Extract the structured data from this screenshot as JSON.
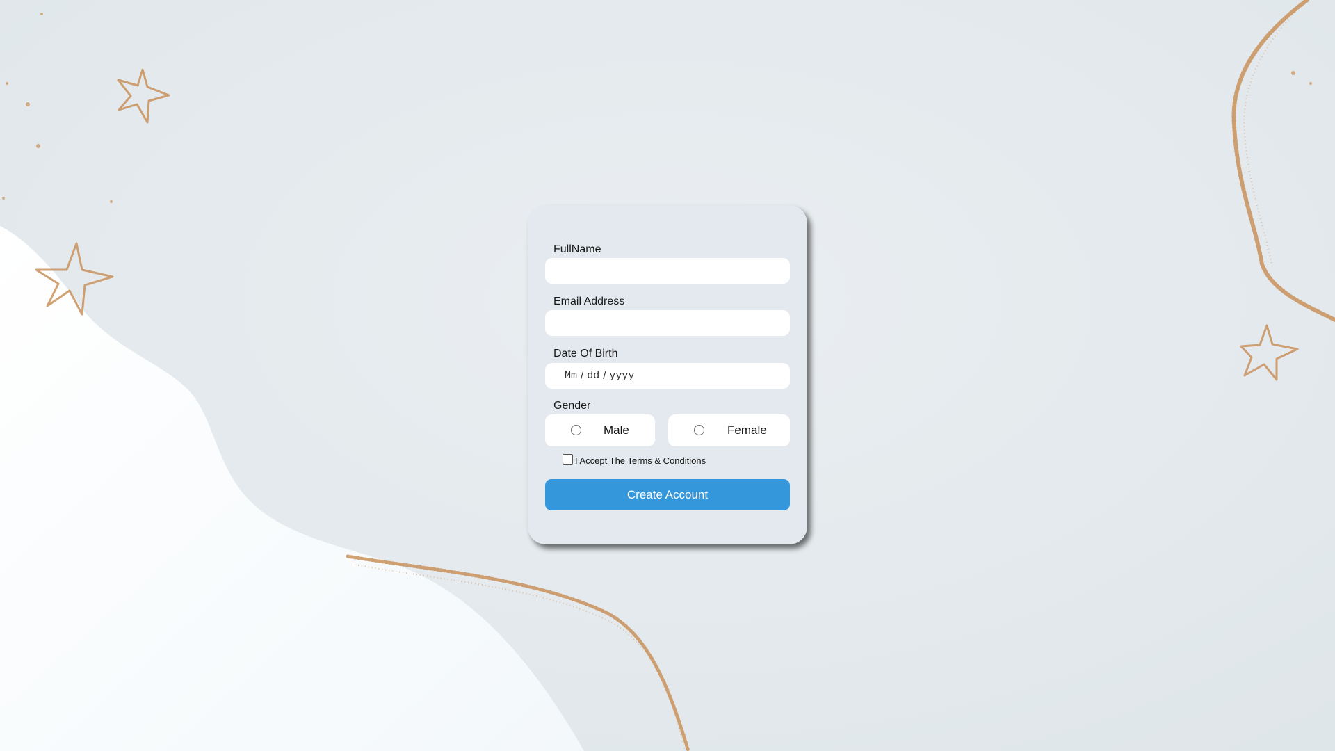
{
  "form": {
    "fullname": {
      "label": "FullName",
      "value": ""
    },
    "email": {
      "label": "Email Address",
      "value": ""
    },
    "dob": {
      "label": "Date Of Birth",
      "month_placeholder": "Mm",
      "day_placeholder": "dd",
      "year_placeholder": "yyyy",
      "separator": "/"
    },
    "gender": {
      "label": "Gender",
      "options": [
        "Male",
        "Female"
      ],
      "selected": null
    },
    "terms": {
      "label": "I Accept The Terms & Conditions",
      "checked": false
    },
    "submit_label": "Create Account"
  },
  "colors": {
    "card": "#e3e9ee",
    "accent": "#3497dc",
    "background": "#e6ebee",
    "gold": "#c8915a"
  },
  "decor": {
    "background_icons": [
      "star-icon",
      "star-icon",
      "star-icon",
      "glitter-swirl"
    ]
  }
}
